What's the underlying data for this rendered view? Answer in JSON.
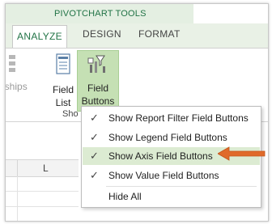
{
  "ribbon": {
    "context_title": "PIVOTCHART TOOLS",
    "tabs": [
      {
        "label": "ANALYZE",
        "active": true
      },
      {
        "label": "DESIGN",
        "active": false
      },
      {
        "label": "FORMAT",
        "active": false
      }
    ],
    "relationships_label": "nships",
    "field_list": {
      "line1": "Field",
      "line2": "List"
    },
    "field_buttons": {
      "line1": "Field",
      "line2": "Buttons ▾"
    },
    "group_label": "Sho"
  },
  "sheet": {
    "column_header": "L"
  },
  "menu": {
    "items": [
      {
        "label": "Show Report Filter Field Buttons",
        "checked": true
      },
      {
        "label": "Show Legend Field Buttons",
        "checked": true
      },
      {
        "label": "Show Axis Field Buttons",
        "checked": true,
        "highlighted": true
      },
      {
        "label": "Show Value Field Buttons",
        "checked": true
      },
      {
        "label": "Hide All",
        "checked": false
      }
    ],
    "check_glyph": "✓"
  },
  "colors": {
    "accent_green": "#217346",
    "highlight": "#dcebd2",
    "button_selected": "#c5e0b4",
    "arrow": "#e06a2a"
  }
}
